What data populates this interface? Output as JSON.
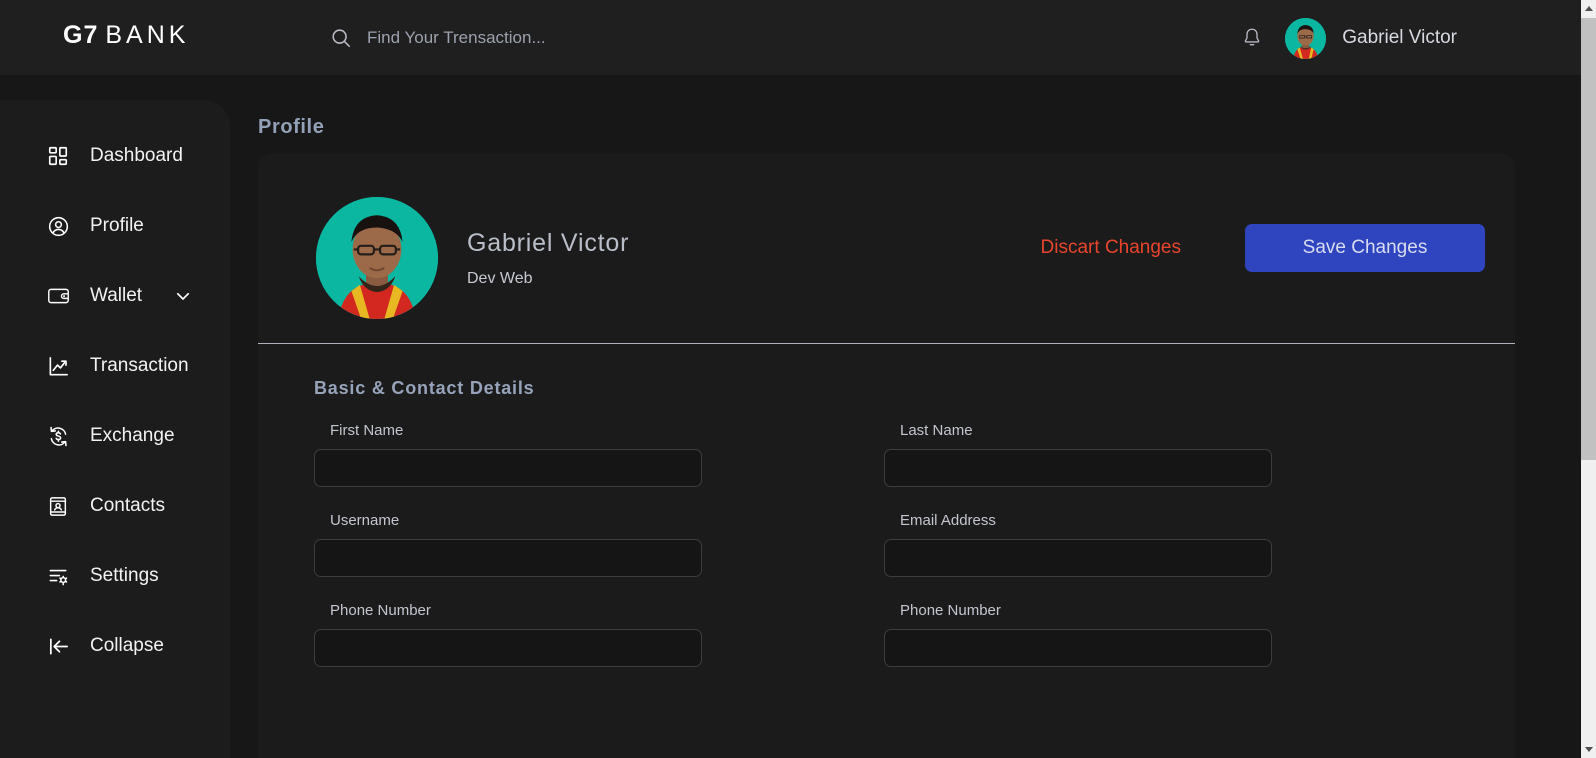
{
  "brand": {
    "mark": "G7",
    "word": "BANK"
  },
  "search": {
    "icon": "search-icon",
    "placeholder": "Find Your Trensaction...",
    "value": ""
  },
  "header": {
    "notification_icon": "bell-icon",
    "username": "Gabriel Victor",
    "avatar_alt": "Gabriel Victor"
  },
  "sidebar": {
    "items": [
      {
        "label": "Dashboard",
        "icon": "grid-dashboard-icon",
        "has_chevron": false
      },
      {
        "label": "Profile",
        "icon": "user-circle-icon",
        "has_chevron": false
      },
      {
        "label": "Wallet",
        "icon": "wallet-icon",
        "has_chevron": true
      },
      {
        "label": "Transaction",
        "icon": "trend-up-chart-icon",
        "has_chevron": false
      },
      {
        "label": "Exchange",
        "icon": "currency-exchange-icon",
        "has_chevron": false
      },
      {
        "label": "Contacts",
        "icon": "contact-card-icon",
        "has_chevron": false
      },
      {
        "label": "Settings",
        "icon": "sliders-gear-icon",
        "has_chevron": false
      },
      {
        "label": "Collapse",
        "icon": "arrow-left-to-line-icon",
        "has_chevron": false
      }
    ]
  },
  "main": {
    "page_title": "Profile",
    "profile": {
      "name": "Gabriel Victor",
      "role": "Dev Web",
      "discard_label": "Discart Changes",
      "save_label": "Save Changes"
    },
    "form": {
      "section_title": "Basic & Contact Details",
      "fields_left": [
        {
          "label": "First Name",
          "value": "",
          "placeholder": ""
        },
        {
          "label": "Username",
          "value": "",
          "placeholder": ""
        },
        {
          "label": "Phone Number",
          "value": "",
          "placeholder": ""
        }
      ],
      "fields_right": [
        {
          "label": "Last Name",
          "value": "",
          "placeholder": ""
        },
        {
          "label": "Email Address",
          "value": "",
          "placeholder": ""
        },
        {
          "label": "Phone Number",
          "value": "",
          "placeholder": ""
        }
      ]
    }
  },
  "colors": {
    "page_bg": "#171717",
    "header_bg": "#1f1f1f",
    "sidebar_bg": "#1c1c1c",
    "card_bg": "#1b1b1b",
    "accent_blue": "#2f45bf",
    "accent_red": "#e8452c",
    "heading_blue_gray": "#92a0b8",
    "avatar_bg": "#0bb7a0",
    "scrollbar_thumb": "#c1c1c1"
  }
}
